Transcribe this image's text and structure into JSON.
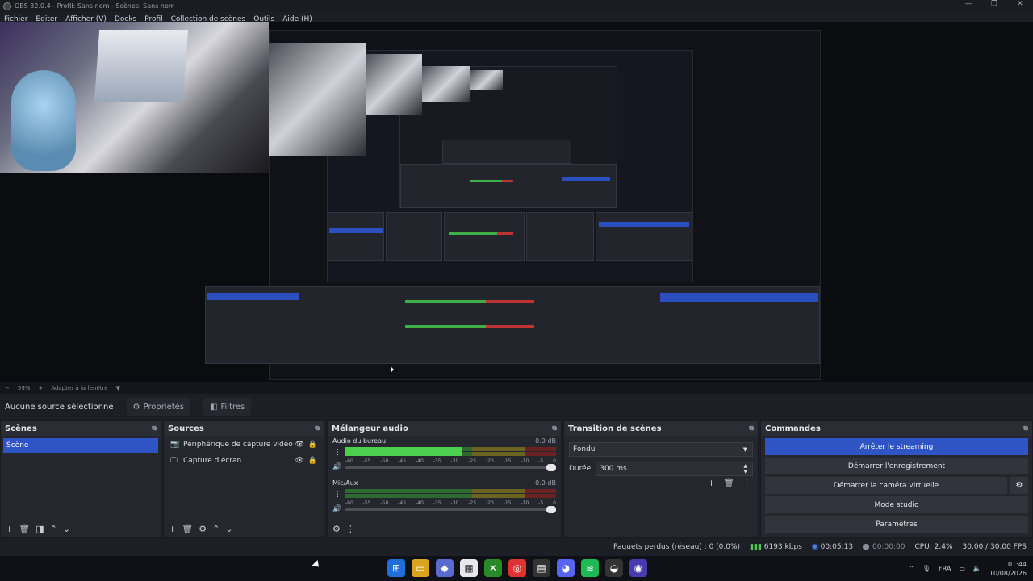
{
  "window": {
    "title": "OBS 32.0.4 - Profil: Sans nom - Scènes: Sans nom",
    "controls": [
      "—",
      "❐",
      "✕"
    ]
  },
  "menu": [
    "Fichier",
    "Editer",
    "Afficher (V)",
    "Docks",
    "Profil",
    "Collection de scènes",
    "Outils",
    "Aide (H)"
  ],
  "preview_toolbar": {
    "zoom": "59%",
    "fit": "Adapter à la fenêtre"
  },
  "source_bar": {
    "no_source": "Aucune source sélectionné",
    "properties": "Propriétés",
    "filters": "Filtres"
  },
  "docks": {
    "scenes": {
      "title": "Scènes",
      "items": [
        "Scène"
      ]
    },
    "sources": {
      "title": "Sources",
      "items": [
        {
          "icon": "camera-icon",
          "label": "Périphérique de capture vidéo"
        },
        {
          "icon": "monitor-icon",
          "label": "Capture d'écran"
        }
      ]
    },
    "mixer": {
      "title": "Mélangeur audio",
      "channels": [
        {
          "name": "Audio du bureau",
          "db": "0.0 dB",
          "level": 0.55
        },
        {
          "name": "Mic/Aux",
          "db": "0.0 dB",
          "level": 0.0
        }
      ],
      "ticks": [
        "-60",
        "-55",
        "-50",
        "-45",
        "-40",
        "-35",
        "-30",
        "-25",
        "-20",
        "-15",
        "-10",
        "-5",
        "0"
      ]
    },
    "transitions": {
      "title": "Transition de scènes",
      "selected": "Fondu",
      "duration_label": "Durée",
      "duration_value": "300 ms"
    },
    "controls": {
      "title": "Commandes",
      "stop_streaming": "Arrêter le streaming",
      "start_recording": "Démarrer l'enregistrement",
      "virtual_camera": "Démarrer la caméra virtuelle",
      "studio_mode": "Mode studio",
      "settings": "Paramètres"
    }
  },
  "status": {
    "dropped": "Paquets perdus (réseau) : 0 (0.0%)",
    "bitrate": "6193 kbps",
    "stream_time": "00:05:13",
    "rec_time": "00:00:00",
    "cpu": "CPU: 2.4%",
    "fps": "30.00 / 30.00 FPS"
  },
  "taskbar": {
    "lang": "FRA",
    "time": "01:44",
    "date": "10/08/2026"
  }
}
